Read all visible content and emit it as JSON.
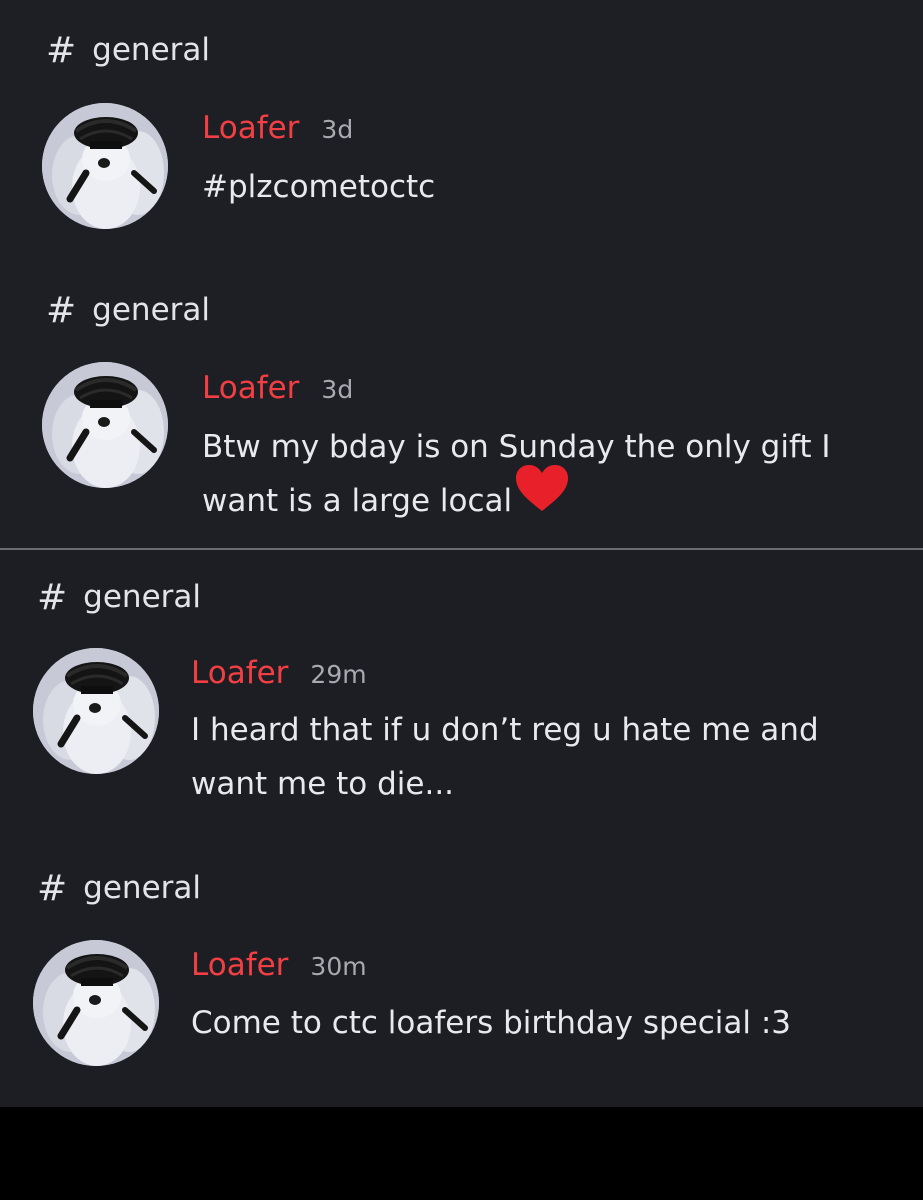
{
  "theme": {
    "background": "#1e1f24",
    "username_color": "#f23f43",
    "timestamp_color": "#a8aab1",
    "text_color": "#e8e9ec",
    "heart_color": "#e8202a"
  },
  "messages": [
    {
      "channel": "general",
      "author": "Loafer",
      "time": "3d",
      "lines": [
        "#plzcometoctc"
      ],
      "avatar_icon": "dog-avatar-icon"
    },
    {
      "channel": "general",
      "author": "Loafer",
      "time": "3d",
      "lines": [
        "Btw my bday is on Sunday the only gift I",
        "want is a large local"
      ],
      "emoji": "red-heart-icon",
      "avatar_icon": "dog-avatar-icon"
    },
    {
      "channel": "general",
      "author": "Loafer",
      "time": "29m",
      "lines": [
        "I heard that if u don’t reg u hate me and",
        "want me to die..."
      ],
      "avatar_icon": "dog-avatar-icon"
    },
    {
      "channel": "general",
      "author": "Loafer",
      "time": "30m",
      "lines": [
        "Come to ctc loafers birthday special :3"
      ],
      "avatar_icon": "dog-avatar-icon"
    }
  ]
}
